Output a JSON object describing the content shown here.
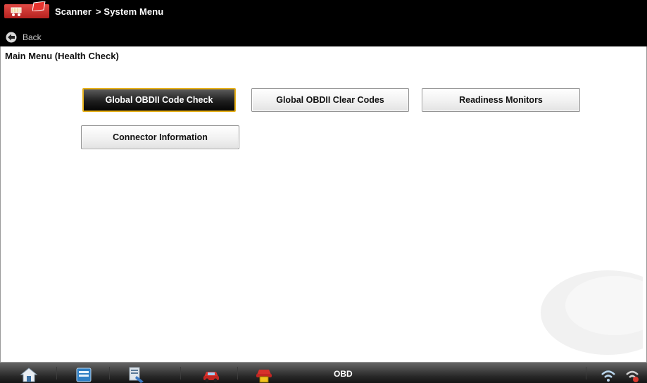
{
  "titlebar": {
    "app_name": "Scanner",
    "breadcrumb": "> System Menu"
  },
  "nav": {
    "back_label": "Back"
  },
  "page": {
    "title": "Main Menu (Health Check)"
  },
  "menu": {
    "items": [
      {
        "label": "Global OBDII Code Check",
        "selected": true
      },
      {
        "label": "Global OBDII Clear Codes",
        "selected": false
      },
      {
        "label": "Readiness Monitors",
        "selected": false
      },
      {
        "label": "Connector Information",
        "selected": false
      }
    ]
  },
  "taskbar": {
    "mode_label": "OBD",
    "icons": [
      "home-icon",
      "scanner-icon",
      "tools-icon",
      "vehicle-icon",
      "vehicle-info-icon",
      "wireless-icon",
      "connection-status-icon"
    ]
  },
  "colors": {
    "titlebar_bg": "#000000",
    "selected_border": "#e8b21a",
    "logo_red": "#c8302c"
  }
}
